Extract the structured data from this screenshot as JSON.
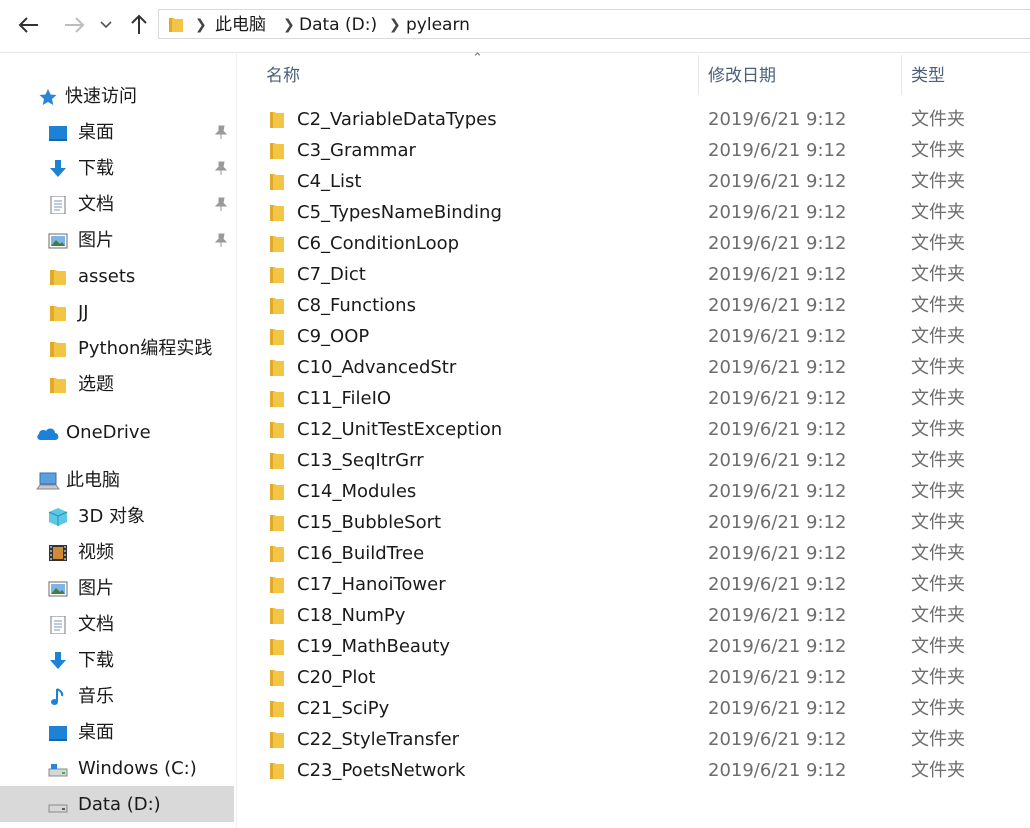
{
  "colors": {
    "folder": "#f3c545",
    "folder_dark": "#e0a92a",
    "accent": "#1e74d2",
    "selected_bg": "#d9d9d9"
  },
  "address": {
    "crumbs": [
      "此电脑",
      "Data (D:)",
      "pylearn"
    ]
  },
  "sidebar": {
    "quick_access": "快速访问",
    "quick_items": [
      {
        "label": "桌面",
        "icon": "desktop-icon",
        "pinned": true
      },
      {
        "label": "下载",
        "icon": "download-icon",
        "pinned": true
      },
      {
        "label": "文档",
        "icon": "document-icon",
        "pinned": true
      },
      {
        "label": "图片",
        "icon": "pictures-icon",
        "pinned": true
      },
      {
        "label": "assets",
        "icon": "folder-icon",
        "pinned": false
      },
      {
        "label": "JJ",
        "icon": "folder-icon",
        "pinned": false
      },
      {
        "label": "Python编程实践",
        "icon": "folder-icon",
        "pinned": false
      },
      {
        "label": "选题",
        "icon": "folder-icon",
        "pinned": false
      }
    ],
    "onedrive": "OneDrive",
    "this_pc": "此电脑",
    "pc_items": [
      {
        "label": "3D 对象",
        "icon": "3d-objects-icon"
      },
      {
        "label": "视频",
        "icon": "videos-icon"
      },
      {
        "label": "图片",
        "icon": "pictures-icon"
      },
      {
        "label": "文档",
        "icon": "document-icon"
      },
      {
        "label": "下载",
        "icon": "download-icon"
      },
      {
        "label": "音乐",
        "icon": "music-icon"
      },
      {
        "label": "桌面",
        "icon": "desktop-icon"
      },
      {
        "label": "Windows (C:)",
        "icon": "drive-c-icon"
      },
      {
        "label": "Data (D:)",
        "icon": "drive-d-icon"
      }
    ]
  },
  "columns": {
    "name": "名称",
    "date": "修改日期",
    "type": "类型"
  },
  "files": [
    {
      "name": "C2_VariableDataTypes",
      "date": "2019/6/21 9:12",
      "type": "文件夹"
    },
    {
      "name": "C3_Grammar",
      "date": "2019/6/21 9:12",
      "type": "文件夹"
    },
    {
      "name": "C4_List",
      "date": "2019/6/21 9:12",
      "type": "文件夹"
    },
    {
      "name": "C5_TypesNameBinding",
      "date": "2019/6/21 9:12",
      "type": "文件夹"
    },
    {
      "name": "C6_ConditionLoop",
      "date": "2019/6/21 9:12",
      "type": "文件夹"
    },
    {
      "name": "C7_Dict",
      "date": "2019/6/21 9:12",
      "type": "文件夹"
    },
    {
      "name": "C8_Functions",
      "date": "2019/6/21 9:12",
      "type": "文件夹"
    },
    {
      "name": "C9_OOP",
      "date": "2019/6/21 9:12",
      "type": "文件夹"
    },
    {
      "name": "C10_AdvancedStr",
      "date": "2019/6/21 9:12",
      "type": "文件夹"
    },
    {
      "name": "C11_FileIO",
      "date": "2019/6/21 9:12",
      "type": "文件夹"
    },
    {
      "name": "C12_UnitTestException",
      "date": "2019/6/21 9:12",
      "type": "文件夹"
    },
    {
      "name": "C13_SeqItrGrr",
      "date": "2019/6/21 9:12",
      "type": "文件夹"
    },
    {
      "name": "C14_Modules",
      "date": "2019/6/21 9:12",
      "type": "文件夹"
    },
    {
      "name": "C15_BubbleSort",
      "date": "2019/6/21 9:12",
      "type": "文件夹"
    },
    {
      "name": "C16_BuildTree",
      "date": "2019/6/21 9:12",
      "type": "文件夹"
    },
    {
      "name": "C17_HanoiTower",
      "date": "2019/6/21 9:12",
      "type": "文件夹"
    },
    {
      "name": "C18_NumPy",
      "date": "2019/6/21 9:12",
      "type": "文件夹"
    },
    {
      "name": "C19_MathBeauty",
      "date": "2019/6/21 9:12",
      "type": "文件夹"
    },
    {
      "name": "C20_Plot",
      "date": "2019/6/21 9:12",
      "type": "文件夹"
    },
    {
      "name": "C21_SciPy",
      "date": "2019/6/21 9:12",
      "type": "文件夹"
    },
    {
      "name": "C22_StyleTransfer",
      "date": "2019/6/21 9:12",
      "type": "文件夹"
    },
    {
      "name": "C23_PoetsNetwork",
      "date": "2019/6/21 9:12",
      "type": "文件夹"
    }
  ]
}
